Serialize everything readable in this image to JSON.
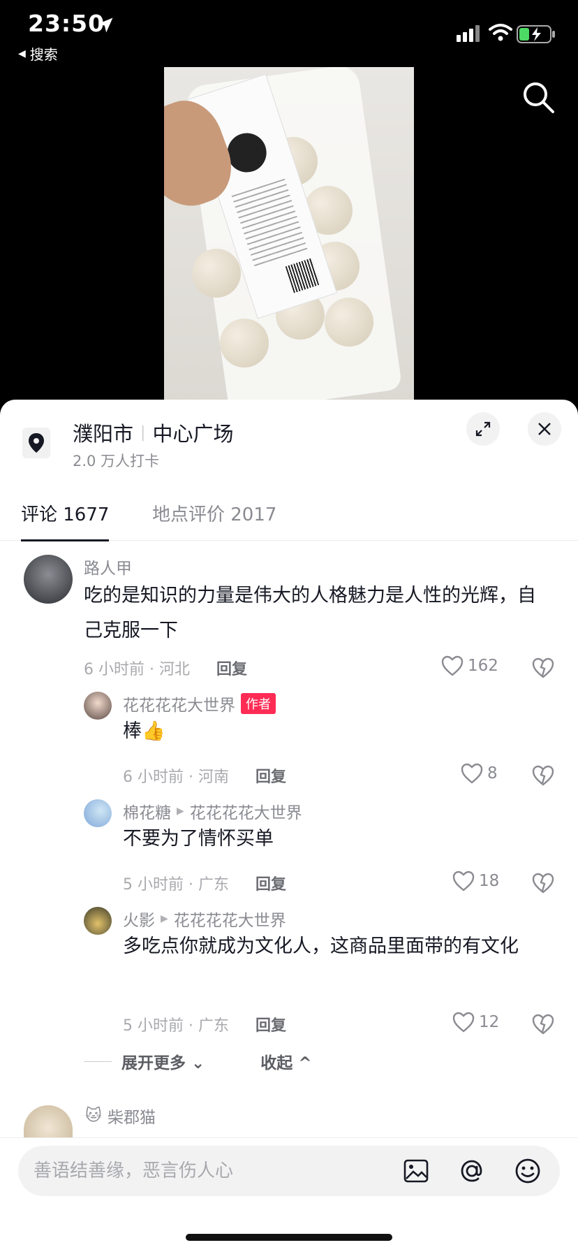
{
  "status_bar": {
    "time": "23:50",
    "back_label": "搜索"
  },
  "place": {
    "city": "濮阳市",
    "spot": "中心广场",
    "checkins": "2.0 万人打卡"
  },
  "tabs": [
    {
      "label": "评论 1677"
    },
    {
      "label": "地点评价 2017"
    }
  ],
  "comments": [
    {
      "user": "路人甲",
      "text": "吃的是知识的力量是伟大的人格魅力是人性的光辉，自己克服一下",
      "time": "6 小时前 · 河北",
      "reply": "回复",
      "likes": "162"
    }
  ],
  "replies": [
    {
      "user": "花花花花大世界",
      "badge": "作者",
      "text": "棒👍",
      "time": "6 小时前 · 河南",
      "reply": "回复",
      "likes": "8"
    },
    {
      "user": "棉花糖",
      "to": "花花花花大世界",
      "text": "不要为了情怀买单",
      "time": "5 小时前 · 广东",
      "reply": "回复",
      "likes": "18"
    },
    {
      "user": "火影",
      "to": "花花花花大世界",
      "text": "多吃点你就成为文化人，这商品里面带的有文化",
      "time": "5 小时前 · 广东",
      "reply": "回复",
      "likes": "12"
    }
  ],
  "expand": {
    "more": "展开更多",
    "collapse": "收起"
  },
  "next_comment": {
    "user": "柴郡猫",
    "emoji": "🐱"
  },
  "input": {
    "placeholder": "善语结善缘，恶言伤人心"
  },
  "icons": [
    "location-arrow-icon",
    "signal-icon",
    "wifi-icon",
    "battery-icon",
    "search-icon",
    "pin-icon",
    "expand-icon",
    "close-icon",
    "heart-icon",
    "dislike-icon",
    "image-icon",
    "at-icon",
    "emoji-icon"
  ]
}
